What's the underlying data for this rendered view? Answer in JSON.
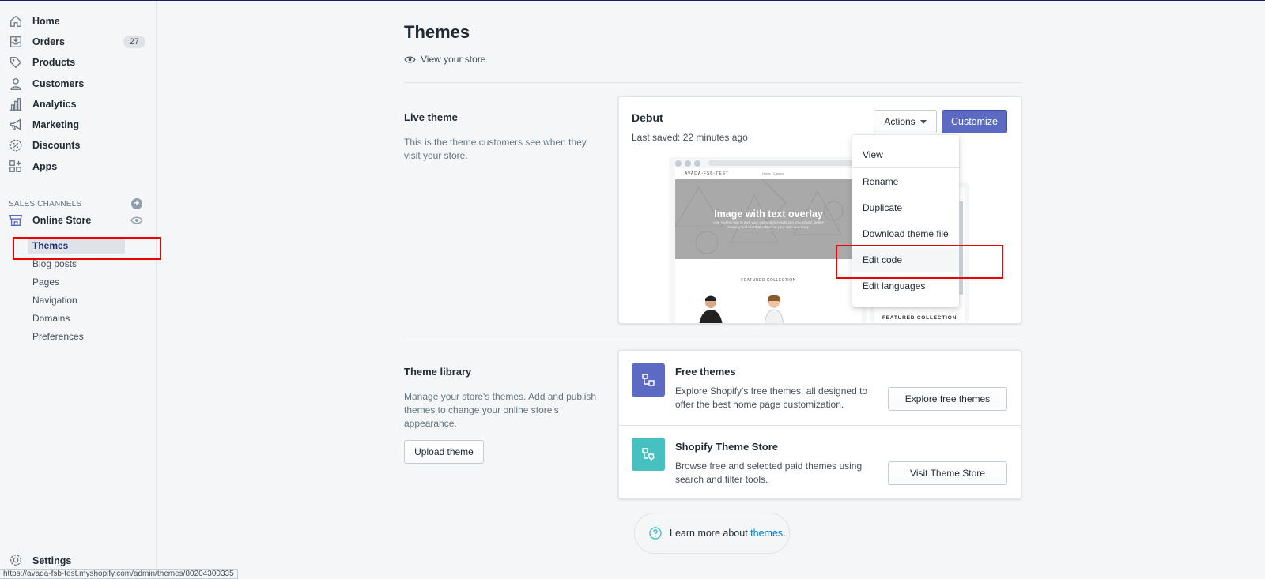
{
  "sidebar": {
    "items": [
      {
        "label": "Home",
        "icon": "home-icon"
      },
      {
        "label": "Orders",
        "icon": "orders-icon",
        "badge": "27"
      },
      {
        "label": "Products",
        "icon": "tag-icon"
      },
      {
        "label": "Customers",
        "icon": "person-icon"
      },
      {
        "label": "Analytics",
        "icon": "bar-chart-icon"
      },
      {
        "label": "Marketing",
        "icon": "megaphone-icon"
      },
      {
        "label": "Discounts",
        "icon": "discount-icon"
      },
      {
        "label": "Apps",
        "icon": "apps-icon"
      }
    ],
    "sales_channels_heading": "SALES CHANNELS",
    "online_store_label": "Online Store",
    "sub_items": [
      "Themes",
      "Blog posts",
      "Pages",
      "Navigation",
      "Domains",
      "Preferences"
    ],
    "settings_label": "Settings"
  },
  "status_url": "https://avada-fsb-test.myshopify.com/admin/themes/80204300335",
  "page": {
    "title": "Themes",
    "view_store": "View your store"
  },
  "live_theme": {
    "heading": "Live theme",
    "description": "This is the theme customers see when they visit your store.",
    "theme_name": "Debut",
    "last_saved": "Last saved: 22 minutes ago",
    "actions_label": "Actions",
    "customize_label": "Customize"
  },
  "preview": {
    "hero_title": "Image with text overlay",
    "hero_sub": "Use overlay text to give your customers insight into your brand. Select imagery and text that relates to your style and story.",
    "featured": "FEATURED COLLECTION",
    "mobile_featured": "FEATURED COLLECTION"
  },
  "actions_menu": [
    "View",
    "Rename",
    "Duplicate",
    "Download theme file",
    "Edit code",
    "Edit languages"
  ],
  "theme_library": {
    "heading": "Theme library",
    "description": "Manage your store's themes. Add and publish themes to change your online store's appearance.",
    "upload_label": "Upload theme",
    "free_title": "Free themes",
    "free_desc": "Explore Shopify's free themes, all designed to offer the best home page customization.",
    "free_button": "Explore free themes",
    "store_title": "Shopify Theme Store",
    "store_desc": "Browse free and selected paid themes using search and filter tools.",
    "store_button": "Visit Theme Store"
  },
  "learn_more": {
    "prefix": "Learn more about ",
    "link": "themes",
    "suffix": "."
  },
  "colors": {
    "primary": "#5c6ac4",
    "teal": "#47c1bf",
    "highlight": "#ee0000"
  }
}
